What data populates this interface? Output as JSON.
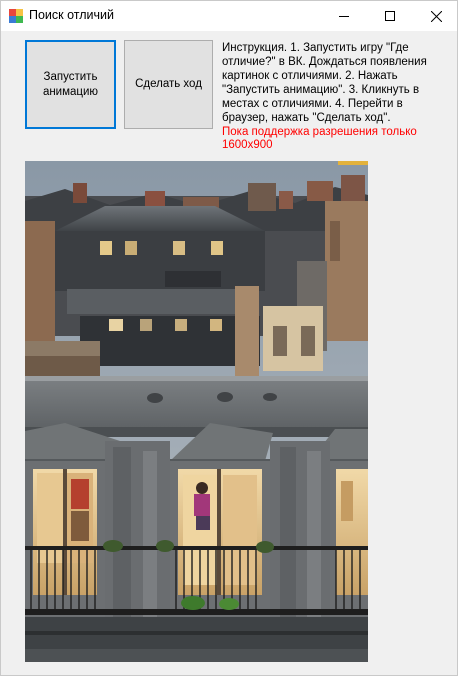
{
  "window": {
    "title": "Поиск отличий",
    "icons": {
      "app": "app-colorful-squares-icon",
      "minimize": "minimize-icon",
      "maximize": "maximize-icon",
      "close": "close-icon"
    }
  },
  "buttons": {
    "start_animation": "Запустить анимацию",
    "make_move": "Сделать ход"
  },
  "instructions": "Инструкция. 1. Запустить игру \"Где отличие?\" в ВК. Дождаться появления картинок с отличиями. 2. Нажать \"Запустить анимацию\". 3. Кликнуть в местах с отличиями. 4. Перейти в браузер, нажать \"Сделать ход\".",
  "warning": "Пока поддержка разрешения только 1600x900",
  "picture": {
    "subject": "paris-rooftops-photo"
  },
  "colors": {
    "accent_border": "#0078d7",
    "warning_text": "#ff0000"
  }
}
